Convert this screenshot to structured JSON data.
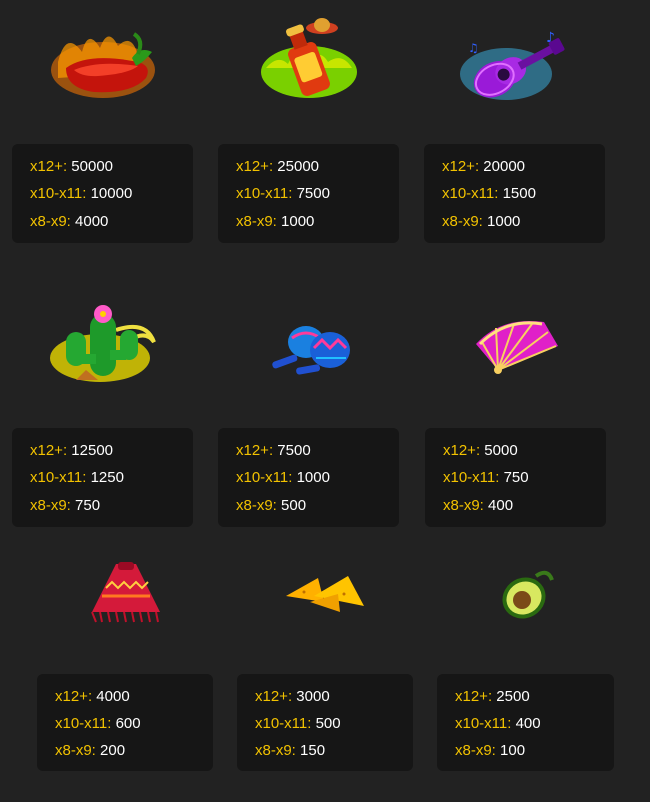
{
  "symbols": [
    {
      "icon": "chili-pepper-icon",
      "payouts": [
        {
          "label": "x12+:",
          "value": "50000"
        },
        {
          "label": "x10-x11:",
          "value": "10000"
        },
        {
          "label": "x8-x9:",
          "value": "4000"
        }
      ]
    },
    {
      "icon": "tequila-bottle-icon",
      "payouts": [
        {
          "label": "x12+:",
          "value": "25000"
        },
        {
          "label": "x10-x11:",
          "value": "7500"
        },
        {
          "label": "x8-x9:",
          "value": "1000"
        }
      ]
    },
    {
      "icon": "guitar-icon",
      "payouts": [
        {
          "label": "x12+:",
          "value": "20000"
        },
        {
          "label": "x10-x11:",
          "value": "1500"
        },
        {
          "label": "x8-x9:",
          "value": "1000"
        }
      ]
    },
    {
      "icon": "cactus-icon",
      "payouts": [
        {
          "label": "x12+:",
          "value": "12500"
        },
        {
          "label": "x10-x11:",
          "value": "1250"
        },
        {
          "label": "x8-x9:",
          "value": "750"
        }
      ]
    },
    {
      "icon": "maracas-icon",
      "payouts": [
        {
          "label": "x12+:",
          "value": "7500"
        },
        {
          "label": "x10-x11:",
          "value": "1000"
        },
        {
          "label": "x8-x9:",
          "value": "500"
        }
      ]
    },
    {
      "icon": "fan-icon",
      "payouts": [
        {
          "label": "x12+:",
          "value": "5000"
        },
        {
          "label": "x10-x11:",
          "value": "750"
        },
        {
          "label": "x8-x9:",
          "value": "400"
        }
      ]
    },
    {
      "icon": "poncho-icon",
      "payouts": [
        {
          "label": "x12+:",
          "value": "4000"
        },
        {
          "label": "x10-x11:",
          "value": "600"
        },
        {
          "label": "x8-x9:",
          "value": "200"
        }
      ]
    },
    {
      "icon": "nachos-icon",
      "payouts": [
        {
          "label": "x12+:",
          "value": "3000"
        },
        {
          "label": "x10-x11:",
          "value": "500"
        },
        {
          "label": "x8-x9:",
          "value": "150"
        }
      ]
    },
    {
      "icon": "avocado-icon",
      "payouts": [
        {
          "label": "x12+:",
          "value": "2500"
        },
        {
          "label": "x10-x11:",
          "value": "400"
        },
        {
          "label": "x8-x9:",
          "value": "100"
        }
      ]
    }
  ],
  "colors": {
    "background": "#222222",
    "card": "#161616",
    "label": "#f2c200",
    "value": "#ffffff"
  }
}
